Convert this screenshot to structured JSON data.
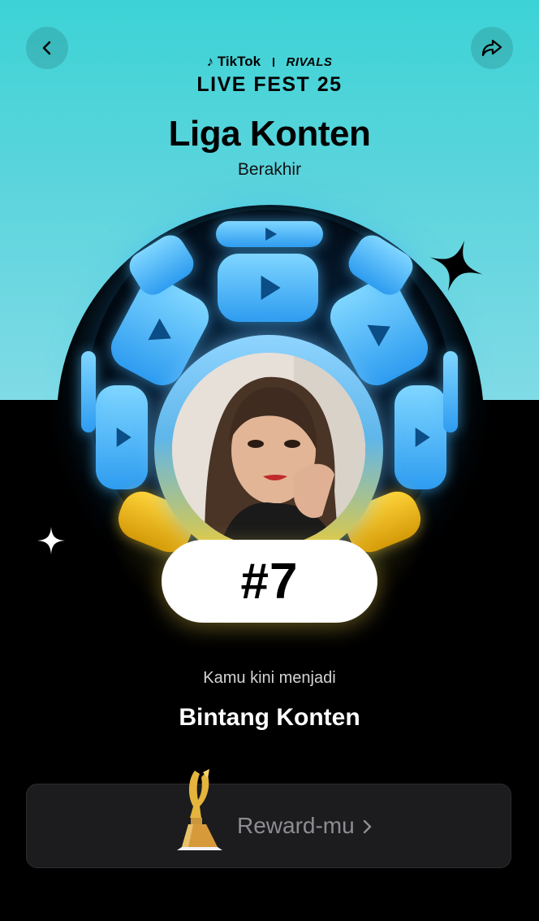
{
  "header": {
    "brand_tiktok": "TikTok",
    "brand_rivals": "RIVALS",
    "event_name": "LIVE FEST 25"
  },
  "contest": {
    "title": "Liga Konten",
    "status": "Berakhir"
  },
  "result": {
    "rank": "#7",
    "caption": "Kamu kini menjadi",
    "headline": "Bintang Konten"
  },
  "reward": {
    "label": "Reward-mu"
  },
  "icons": {
    "back": "chevron-left-icon",
    "share": "share-arrow-icon",
    "reward_chevron": "chevron-right-icon"
  },
  "colors": {
    "top_background": "#4dd3da",
    "page_background": "#000000",
    "accent_blue": "#4ab2f5",
    "accent_yellow": "#f2c71c",
    "reward_card": "#1c1c1e"
  }
}
